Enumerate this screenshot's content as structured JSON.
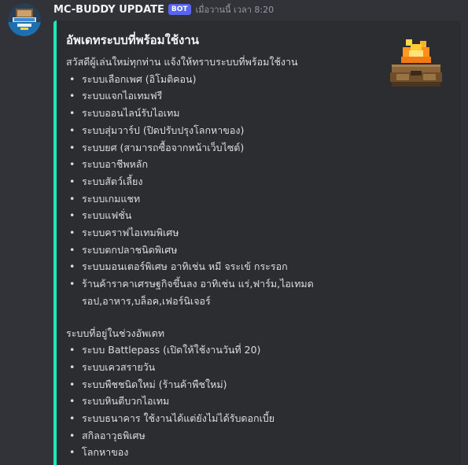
{
  "message": {
    "username": "MC-BUDDY UPDATE",
    "bot_tag": "BOT",
    "timestamp": "เมื่อวานนี้ เวลา 8:20"
  },
  "embed": {
    "accent_color": "#1de9b6",
    "title": "อัพเดทระบบที่พร้อมใช้งาน",
    "intro": "สวัสดีผู้เล่นใหม่ทุกท่าน แจ้งให้ทราบระบบที่พร้อมใช้งาน",
    "ready_systems": [
      "ระบบเลือกเพศ (อิโมติคอน)",
      "ระบบแจกไอเทมฟรี",
      "ระบบออนไลน์รับไอเทม",
      "ระบบสุ่มวาร์ป (ปิดปรับปรุงโลกหาของ)",
      "ระบบยศ (สามารถซื้อจากหน้าเว็บไซต์)",
      "ระบบอาชีพหลัก",
      "ระบบสัตว์เลี้ยง",
      "ระบบเกมแชท",
      "ระบบแฟชั่น",
      "ระบบคราฟไอเทมพิเศษ",
      "ระบบตกปลาชนิดพิเศษ",
      "ระบบมอนเตอร์พิเศษ อาทิเช่น หมี จระเข้ กระรอก",
      "ร้านค้าราคาเศรษฐกิจขึ้นลง อาทิเช่น แร่,ฟาร์ม,ไอเทมดรอป,อาหาร,บล็อค,เฟอร์นิเจอร์"
    ],
    "upcoming_heading": "ระบบที่อยู่ในช่วงอัพเดท",
    "upcoming_systems": [
      "ระบบ Battlepass (เปิดให้ใช้งานวันที่ 20)",
      "ระบบเควสรายวัน",
      "ระบบพืชชนิดใหม่ (ร้านค้าพืชใหม่)",
      "ระบบหินตีบวกไอเทม",
      "ระบบธนาคาร ใช้งานได้แต่ยังไม่ได้รับดอกเบี้ย",
      "สกิลอาวุธพิเศษ",
      "โลกหาของ"
    ]
  }
}
